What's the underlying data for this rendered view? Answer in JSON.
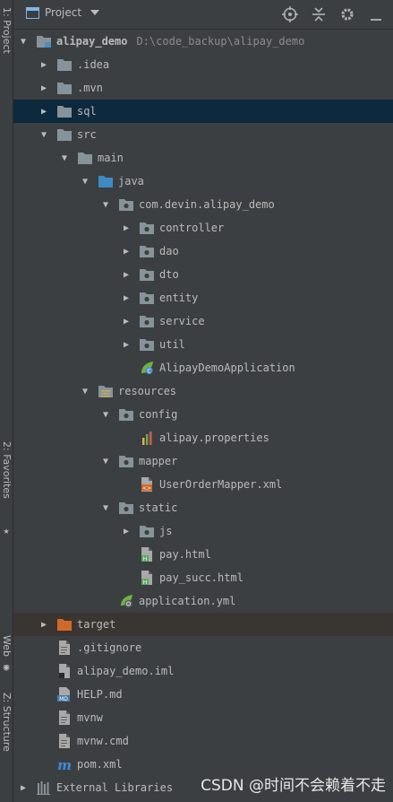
{
  "sidebar": {
    "tabs": [
      {
        "label": "1: Project"
      },
      {
        "label": "2: Favorites"
      },
      {
        "label": "Web"
      },
      {
        "label": "Z: Structure"
      }
    ]
  },
  "toolbar": {
    "title": "Project"
  },
  "tree": [
    {
      "label": "alipay_demo",
      "extra": "D:\\code_backup\\alipay_demo",
      "icon": "module-folder-icon",
      "depth": 0,
      "arrow": "down",
      "bold": true
    },
    {
      "label": ".idea",
      "icon": "folder-icon",
      "depth": 1,
      "arrow": "right"
    },
    {
      "label": ".mvn",
      "icon": "folder-icon",
      "depth": 1,
      "arrow": "right"
    },
    {
      "label": "sql",
      "icon": "folder-icon",
      "depth": 1,
      "arrow": "right",
      "selected": true
    },
    {
      "label": "src",
      "icon": "folder-icon",
      "depth": 1,
      "arrow": "down"
    },
    {
      "label": "main",
      "icon": "folder-icon",
      "depth": 2,
      "arrow": "down"
    },
    {
      "label": "java",
      "icon": "source-folder-icon",
      "depth": 3,
      "arrow": "down"
    },
    {
      "label": "com.devin.alipay_demo",
      "icon": "package-icon",
      "depth": 4,
      "arrow": "down"
    },
    {
      "label": "controller",
      "icon": "package-icon",
      "depth": 5,
      "arrow": "right"
    },
    {
      "label": "dao",
      "icon": "package-icon",
      "depth": 5,
      "arrow": "right"
    },
    {
      "label": "dto",
      "icon": "package-icon",
      "depth": 5,
      "arrow": "right"
    },
    {
      "label": "entity",
      "icon": "package-icon",
      "depth": 5,
      "arrow": "right"
    },
    {
      "label": "service",
      "icon": "package-icon",
      "depth": 5,
      "arrow": "right"
    },
    {
      "label": "util",
      "icon": "package-icon",
      "depth": 5,
      "arrow": "right"
    },
    {
      "label": "AlipayDemoApplication",
      "icon": "spring-app-icon",
      "depth": 5,
      "arrow": "none"
    },
    {
      "label": "resources",
      "icon": "resources-folder-icon",
      "depth": 3,
      "arrow": "down"
    },
    {
      "label": "config",
      "icon": "package-icon",
      "depth": 4,
      "arrow": "down"
    },
    {
      "label": "alipay.properties",
      "icon": "properties-file-icon",
      "depth": 5,
      "arrow": "none"
    },
    {
      "label": "mapper",
      "icon": "package-icon",
      "depth": 4,
      "arrow": "down"
    },
    {
      "label": "UserOrderMapper.xml",
      "icon": "xml-file-icon",
      "depth": 5,
      "arrow": "none"
    },
    {
      "label": "static",
      "icon": "package-icon",
      "depth": 4,
      "arrow": "down"
    },
    {
      "label": "js",
      "icon": "package-icon",
      "depth": 5,
      "arrow": "right"
    },
    {
      "label": "pay.html",
      "icon": "html-file-icon",
      "depth": 5,
      "arrow": "none"
    },
    {
      "label": "pay_succ.html",
      "icon": "html-file-icon",
      "depth": 5,
      "arrow": "none"
    },
    {
      "label": "application.yml",
      "icon": "spring-config-icon",
      "depth": 4,
      "arrow": "none"
    },
    {
      "label": "target",
      "icon": "excluded-folder-icon",
      "depth": 1,
      "arrow": "right",
      "excluded": true
    },
    {
      "label": ".gitignore",
      "icon": "text-file-icon",
      "depth": 1,
      "arrow": "none"
    },
    {
      "label": "alipay_demo.iml",
      "icon": "iml-file-icon",
      "depth": 1,
      "arrow": "none"
    },
    {
      "label": "HELP.md",
      "icon": "markdown-file-icon",
      "depth": 1,
      "arrow": "none"
    },
    {
      "label": "mvnw",
      "icon": "text-file-icon",
      "depth": 1,
      "arrow": "none"
    },
    {
      "label": "mvnw.cmd",
      "icon": "text-file-icon",
      "depth": 1,
      "arrow": "none"
    },
    {
      "label": "pom.xml",
      "icon": "maven-file-icon",
      "depth": 1,
      "arrow": "none"
    },
    {
      "label": "External Libraries",
      "icon": "libraries-icon",
      "depth": 0,
      "arrow": "right"
    }
  ],
  "watermark": "CSDN @时间不会赖着不走"
}
